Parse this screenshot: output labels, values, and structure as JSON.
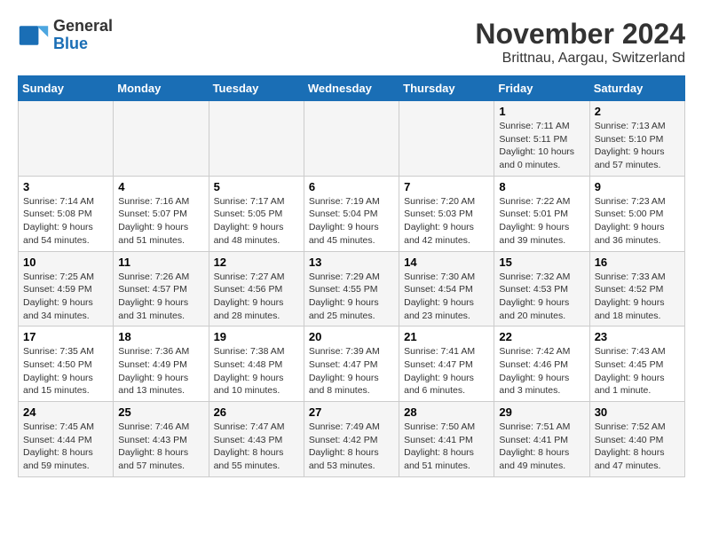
{
  "logo": {
    "line1": "General",
    "line2": "Blue"
  },
  "title": "November 2024",
  "subtitle": "Brittnau, Aargau, Switzerland",
  "days_of_week": [
    "Sunday",
    "Monday",
    "Tuesday",
    "Wednesday",
    "Thursday",
    "Friday",
    "Saturday"
  ],
  "weeks": [
    [
      {
        "day": "",
        "info": ""
      },
      {
        "day": "",
        "info": ""
      },
      {
        "day": "",
        "info": ""
      },
      {
        "day": "",
        "info": ""
      },
      {
        "day": "",
        "info": ""
      },
      {
        "day": "1",
        "info": "Sunrise: 7:11 AM\nSunset: 5:11 PM\nDaylight: 10 hours and 0 minutes."
      },
      {
        "day": "2",
        "info": "Sunrise: 7:13 AM\nSunset: 5:10 PM\nDaylight: 9 hours and 57 minutes."
      }
    ],
    [
      {
        "day": "3",
        "info": "Sunrise: 7:14 AM\nSunset: 5:08 PM\nDaylight: 9 hours and 54 minutes."
      },
      {
        "day": "4",
        "info": "Sunrise: 7:16 AM\nSunset: 5:07 PM\nDaylight: 9 hours and 51 minutes."
      },
      {
        "day": "5",
        "info": "Sunrise: 7:17 AM\nSunset: 5:05 PM\nDaylight: 9 hours and 48 minutes."
      },
      {
        "day": "6",
        "info": "Sunrise: 7:19 AM\nSunset: 5:04 PM\nDaylight: 9 hours and 45 minutes."
      },
      {
        "day": "7",
        "info": "Sunrise: 7:20 AM\nSunset: 5:03 PM\nDaylight: 9 hours and 42 minutes."
      },
      {
        "day": "8",
        "info": "Sunrise: 7:22 AM\nSunset: 5:01 PM\nDaylight: 9 hours and 39 minutes."
      },
      {
        "day": "9",
        "info": "Sunrise: 7:23 AM\nSunset: 5:00 PM\nDaylight: 9 hours and 36 minutes."
      }
    ],
    [
      {
        "day": "10",
        "info": "Sunrise: 7:25 AM\nSunset: 4:59 PM\nDaylight: 9 hours and 34 minutes."
      },
      {
        "day": "11",
        "info": "Sunrise: 7:26 AM\nSunset: 4:57 PM\nDaylight: 9 hours and 31 minutes."
      },
      {
        "day": "12",
        "info": "Sunrise: 7:27 AM\nSunset: 4:56 PM\nDaylight: 9 hours and 28 minutes."
      },
      {
        "day": "13",
        "info": "Sunrise: 7:29 AM\nSunset: 4:55 PM\nDaylight: 9 hours and 25 minutes."
      },
      {
        "day": "14",
        "info": "Sunrise: 7:30 AM\nSunset: 4:54 PM\nDaylight: 9 hours and 23 minutes."
      },
      {
        "day": "15",
        "info": "Sunrise: 7:32 AM\nSunset: 4:53 PM\nDaylight: 9 hours and 20 minutes."
      },
      {
        "day": "16",
        "info": "Sunrise: 7:33 AM\nSunset: 4:52 PM\nDaylight: 9 hours and 18 minutes."
      }
    ],
    [
      {
        "day": "17",
        "info": "Sunrise: 7:35 AM\nSunset: 4:50 PM\nDaylight: 9 hours and 15 minutes."
      },
      {
        "day": "18",
        "info": "Sunrise: 7:36 AM\nSunset: 4:49 PM\nDaylight: 9 hours and 13 minutes."
      },
      {
        "day": "19",
        "info": "Sunrise: 7:38 AM\nSunset: 4:48 PM\nDaylight: 9 hours and 10 minutes."
      },
      {
        "day": "20",
        "info": "Sunrise: 7:39 AM\nSunset: 4:47 PM\nDaylight: 9 hours and 8 minutes."
      },
      {
        "day": "21",
        "info": "Sunrise: 7:41 AM\nSunset: 4:47 PM\nDaylight: 9 hours and 6 minutes."
      },
      {
        "day": "22",
        "info": "Sunrise: 7:42 AM\nSunset: 4:46 PM\nDaylight: 9 hours and 3 minutes."
      },
      {
        "day": "23",
        "info": "Sunrise: 7:43 AM\nSunset: 4:45 PM\nDaylight: 9 hours and 1 minute."
      }
    ],
    [
      {
        "day": "24",
        "info": "Sunrise: 7:45 AM\nSunset: 4:44 PM\nDaylight: 8 hours and 59 minutes."
      },
      {
        "day": "25",
        "info": "Sunrise: 7:46 AM\nSunset: 4:43 PM\nDaylight: 8 hours and 57 minutes."
      },
      {
        "day": "26",
        "info": "Sunrise: 7:47 AM\nSunset: 4:43 PM\nDaylight: 8 hours and 55 minutes."
      },
      {
        "day": "27",
        "info": "Sunrise: 7:49 AM\nSunset: 4:42 PM\nDaylight: 8 hours and 53 minutes."
      },
      {
        "day": "28",
        "info": "Sunrise: 7:50 AM\nSunset: 4:41 PM\nDaylight: 8 hours and 51 minutes."
      },
      {
        "day": "29",
        "info": "Sunrise: 7:51 AM\nSunset: 4:41 PM\nDaylight: 8 hours and 49 minutes."
      },
      {
        "day": "30",
        "info": "Sunrise: 7:52 AM\nSunset: 4:40 PM\nDaylight: 8 hours and 47 minutes."
      }
    ]
  ]
}
